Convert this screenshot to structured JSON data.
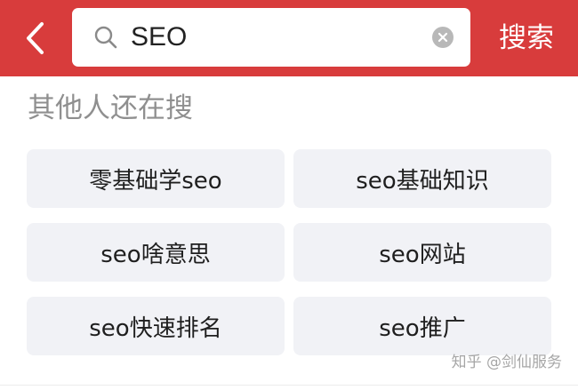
{
  "colors": {
    "header_background": "#d83c3c",
    "chip_background": "#f1f2f6",
    "section_title": "#8f8f8f"
  },
  "header": {
    "back_icon": "chevron-left-icon",
    "search_icon": "search-icon",
    "query": "SEO",
    "clear_icon": "clear-circle-icon",
    "search_button_label": "搜索"
  },
  "section": {
    "title": "其他人还在搜"
  },
  "suggestions": [
    "零基础学seo",
    "seo基础知识",
    "seo啥意思",
    "seo网站",
    "seo快速排名",
    "seo推广"
  ],
  "watermark": "知乎 @剑仙服务"
}
